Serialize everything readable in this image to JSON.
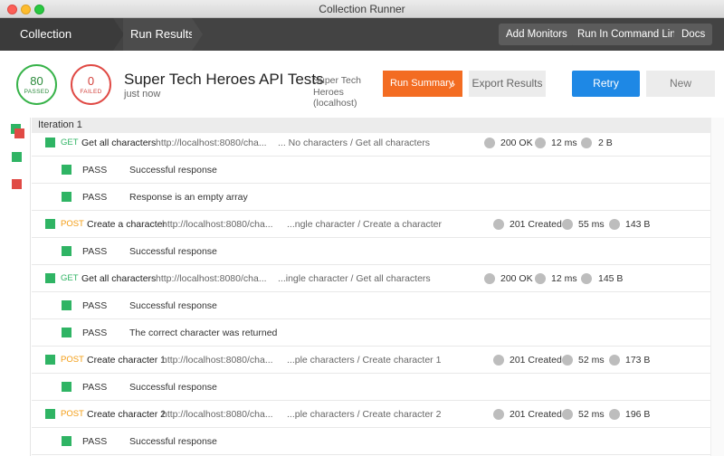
{
  "window": {
    "title": "Collection Runner"
  },
  "nav": {
    "crumb_runner": "Collection Runner",
    "crumb_results": "Run Results",
    "add_monitors": "Add Monitors",
    "run_cli": "Run In Command Line",
    "docs": "Docs"
  },
  "summary": {
    "passed_count": "80",
    "passed_label": "PASSED",
    "failed_count": "0",
    "failed_label": "FAILED",
    "collection_name": "Super Tech Heroes API Tests",
    "run_time": "just now",
    "environment": "Super Tech Heroes (localhost)",
    "run_summary_label": "Run Summary",
    "export_label": "Export Results",
    "retry_label": "Retry",
    "new_label": "New"
  },
  "colors": {
    "pass": "#2fb464",
    "fail": "#e04a45",
    "accent": "#f36c22",
    "primary": "#1e88e5"
  },
  "iteration": {
    "label": "Iteration 1"
  },
  "rows": [
    {
      "kind": "request",
      "method": "GET",
      "name": "Get all characters",
      "url": "http://localhost:8080/cha...",
      "path": "... No characters / Get all characters",
      "status": "200 OK",
      "time": "12 ms",
      "size": "2 B"
    },
    {
      "kind": "test",
      "status": "PASS",
      "name": "Successful response"
    },
    {
      "kind": "test",
      "status": "PASS",
      "name": "Response is an empty array"
    },
    {
      "kind": "request",
      "method": "POST",
      "name": "Create a character",
      "url": "http://localhost:8080/cha...",
      "path": "...ngle character / Create a character",
      "status": "201 Created",
      "time": "55 ms",
      "size": "143 B"
    },
    {
      "kind": "test",
      "status": "PASS",
      "name": "Successful response"
    },
    {
      "kind": "request",
      "method": "GET",
      "name": "Get all characters",
      "url": "http://localhost:8080/cha...",
      "path": "...ingle character / Get all characters",
      "status": "200 OK",
      "time": "12 ms",
      "size": "145 B"
    },
    {
      "kind": "test",
      "status": "PASS",
      "name": "Successful response"
    },
    {
      "kind": "test",
      "status": "PASS",
      "name": "The correct character was returned"
    },
    {
      "kind": "request",
      "method": "POST",
      "name": "Create character 1",
      "url": "http://localhost:8080/cha...",
      "path": "...ple characters / Create character 1",
      "status": "201 Created",
      "time": "52 ms",
      "size": "173 B"
    },
    {
      "kind": "test",
      "status": "PASS",
      "name": "Successful response"
    },
    {
      "kind": "request",
      "method": "POST",
      "name": "Create character 2",
      "url": "http://localhost:8080/cha...",
      "path": "...ple characters / Create character 2",
      "status": "201 Created",
      "time": "52 ms",
      "size": "196 B"
    },
    {
      "kind": "test",
      "status": "PASS",
      "name": "Successful response"
    }
  ]
}
